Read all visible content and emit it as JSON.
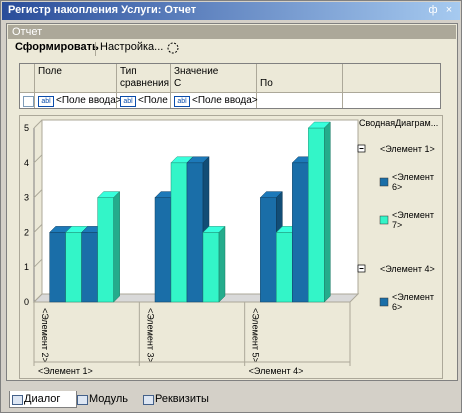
{
  "window": {
    "title": "Регистр накопления Услуги: Отчет",
    "pin": "ф",
    "close": "×"
  },
  "panel": {
    "title": "Отчет"
  },
  "toolbar": {
    "generate": "Сформировать",
    "settings": "Настройка..."
  },
  "grid": {
    "headers": [
      "Поле",
      "Тип",
      "сравнения",
      "Значение",
      "С",
      "По"
    ],
    "row": {
      "field": "<Поле ввода>",
      "compare": "<Поле",
      "value": "<Поле ввода>"
    }
  },
  "chart_data": {
    "type": "bar",
    "title": "СводнаяДиаграм...",
    "ylim": [
      0,
      5
    ],
    "yticks": [
      "0",
      "1",
      "2",
      "3",
      "4",
      "5"
    ],
    "categories": [
      "<Элемент 2>",
      "<Элемент 3>",
      "<Элемент 5>"
    ],
    "groups": [
      "<Элемент 1>",
      "<Элемент 4>"
    ],
    "series": [
      {
        "name": "<Элемент 6>",
        "color": "#1a6ea8",
        "values": [
          2,
          3,
          3
        ]
      },
      {
        "name": "<Элемент 7>",
        "color": "#33f5c8",
        "values": [
          2,
          4,
          2
        ]
      },
      {
        "name": "<Элемент 6>",
        "color": "#1a6ea8",
        "values": [
          2,
          4,
          4
        ]
      },
      {
        "name": "<Элемент 7>",
        "color": "#33f5c8",
        "values": [
          3,
          2,
          5
        ]
      }
    ],
    "legend": [
      {
        "group": "<Элемент 1>",
        "items": [
          {
            "label": "<Элемент 6>",
            "color": "#1a6ea8"
          },
          {
            "label": "<Элемент 7>",
            "color": "#33f5c8"
          }
        ]
      },
      {
        "group": "<Элемент 4>",
        "items": [
          {
            "label": "<Элемент 6>",
            "color": "#1a6ea8"
          }
        ]
      }
    ],
    "legend_position": "right"
  },
  "tabs": [
    "Диалог",
    "Модуль",
    "Реквизиты"
  ]
}
